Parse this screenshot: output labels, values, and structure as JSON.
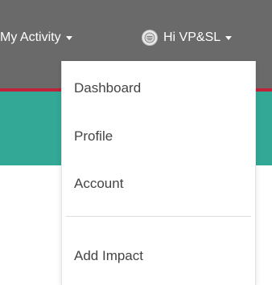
{
  "header": {
    "activity_label": "My Activity",
    "user_greeting": "Hi VP&SL"
  },
  "dropdown": {
    "items": [
      {
        "label": "Dashboard"
      },
      {
        "label": "Profile"
      },
      {
        "label": "Account"
      },
      {
        "label": "Add Impact"
      }
    ]
  },
  "colors": {
    "header_bg": "#6a6a6a",
    "accent_red": "#c0223a",
    "teal": "#33a896",
    "menu_text": "#444444"
  },
  "icons": {
    "avatar": "user-avatar-icon",
    "caret": "caret-down-icon"
  }
}
